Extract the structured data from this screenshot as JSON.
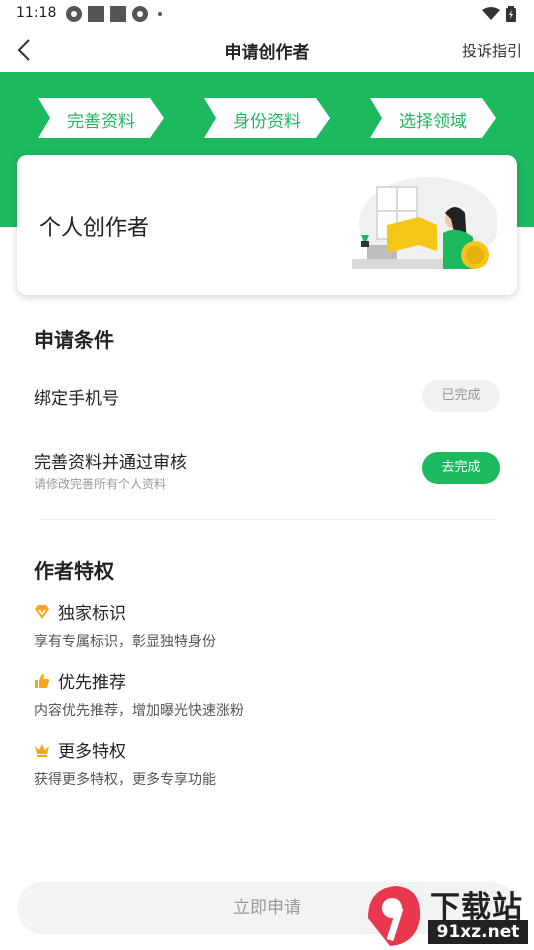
{
  "status_bar": {
    "time": "11:18"
  },
  "nav": {
    "title": "申请创作者",
    "help": "投诉指引"
  },
  "steps": [
    "完善资料",
    "身份资料",
    "选择领域"
  ],
  "card": {
    "title": "个人创作者"
  },
  "conditions": {
    "title": "申请条件",
    "items": [
      {
        "label": "绑定手机号",
        "sub": "",
        "button": "已完成"
      },
      {
        "label": "完善资料并通过审核",
        "sub": "请修改完善所有个人资料",
        "button": "去完成"
      }
    ]
  },
  "privileges": {
    "title": "作者特权",
    "items": [
      {
        "title": "独家标识",
        "desc": "享有专属标识，彰显独特身份",
        "icon": "diamond-icon"
      },
      {
        "title": "优先推荐",
        "desc": "内容优先推荐，增加曝光快速涨粉",
        "icon": "thumbs-up-icon"
      },
      {
        "title": "更多特权",
        "desc": "获得更多特权，更多专享功能",
        "icon": "crown-icon"
      }
    ]
  },
  "apply_button": "立即申请",
  "watermark": {
    "top": "下载站",
    "bottom": "91xz.net"
  },
  "colors": {
    "brand_green": "#1db95f",
    "privilege_orange": "#f5a623"
  }
}
